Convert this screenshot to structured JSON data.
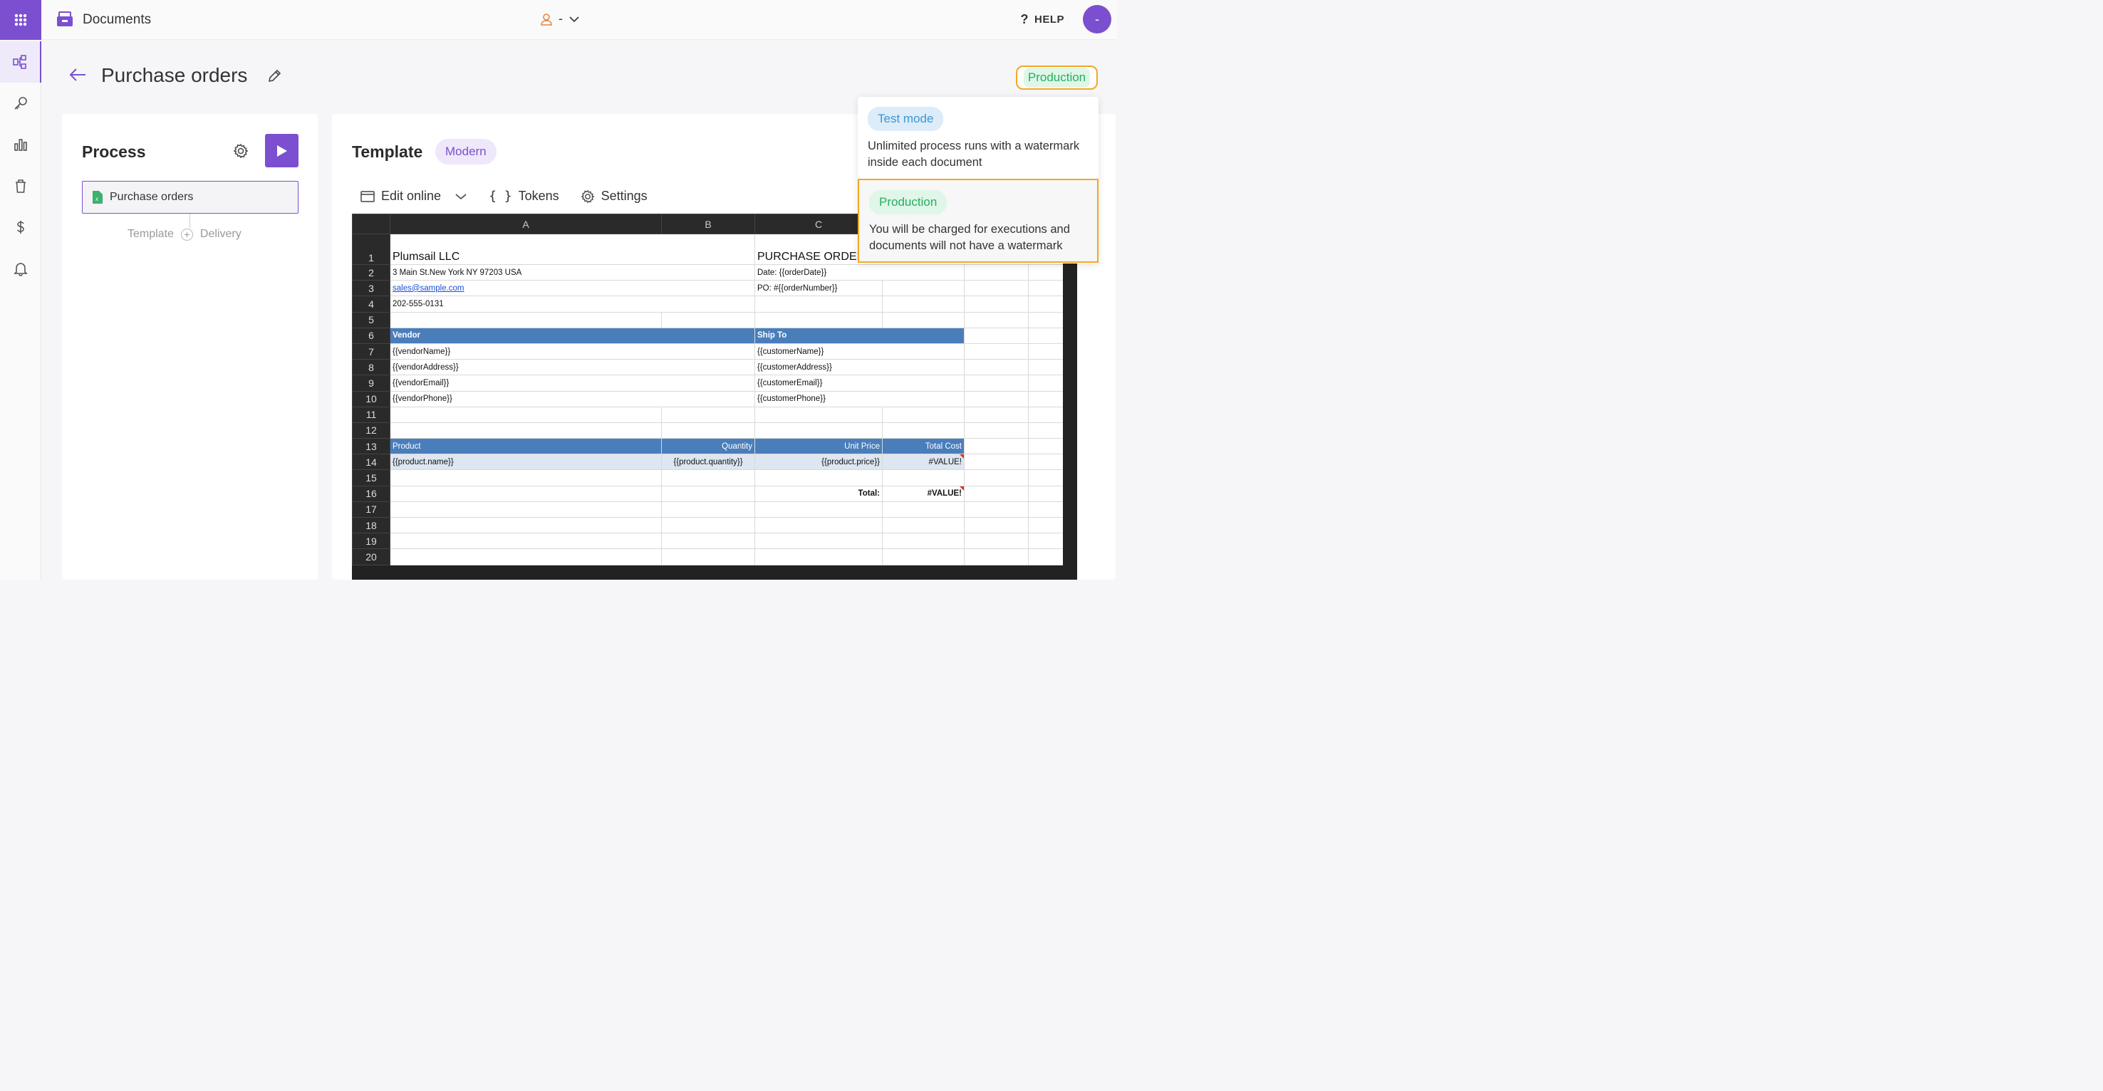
{
  "app": {
    "title": "Documents",
    "user_label": "-",
    "help_label": "HELP",
    "avatar_initial": "-"
  },
  "page": {
    "title": "Purchase orders",
    "mode_label": "Production"
  },
  "process": {
    "heading": "Process",
    "document_item": "Purchase orders",
    "steps": [
      "Template",
      "Delivery"
    ]
  },
  "template": {
    "heading": "Template",
    "badge": "Modern",
    "toolbar": {
      "edit_online": "Edit online",
      "tokens": "Tokens",
      "settings": "Settings"
    }
  },
  "sheet": {
    "columns": [
      "A",
      "B",
      "C"
    ],
    "rows": [
      "1",
      "2",
      "3",
      "4",
      "5",
      "6",
      "7",
      "8",
      "9",
      "10",
      "11",
      "12",
      "13",
      "14",
      "15",
      "16",
      "17",
      "18",
      "19",
      "20"
    ],
    "company": "Plumsail LLC",
    "doc_title": "PURCHASE ORDER",
    "address": "3 Main St.New York NY 97203 USA",
    "email": "sales@sample.com",
    "phone": "202-555-0131",
    "date_token": "Date: {{orderDate}}",
    "po_token": "PO: #{{orderNumber}}",
    "vendor_header": "Vendor",
    "shipto_header": "Ship To",
    "vendor": [
      "{{vendorName}}",
      "{{vendorAddress}}",
      "{{vendorEmail}}",
      "{{vendorPhone}}"
    ],
    "customer": [
      "{{customerName}}",
      "{{customerAddress}}",
      "{{customerEmail}}",
      "{{customerPhone}}"
    ],
    "table_headers": [
      "Product",
      "Quantity",
      "Unit Price",
      "Total Cost"
    ],
    "item_row": [
      "{{product.name}}",
      "{{product.quantity}}",
      "{{product.price}}",
      "#VALUE!"
    ],
    "total_label": "Total:",
    "total_value": "#VALUE!"
  },
  "mode_dropdown": {
    "options": [
      {
        "tag": "Test mode",
        "description": "Unlimited process runs with a watermark inside each document"
      },
      {
        "tag": "Production",
        "description": "You will be charged for executions and documents will not have a watermark"
      }
    ]
  },
  "colors": {
    "accent": "#7b4fd0",
    "highlight": "#f5a623",
    "production": "#27ae60",
    "test": "#3a97d4",
    "sheet_header": "#4a7ebb"
  }
}
